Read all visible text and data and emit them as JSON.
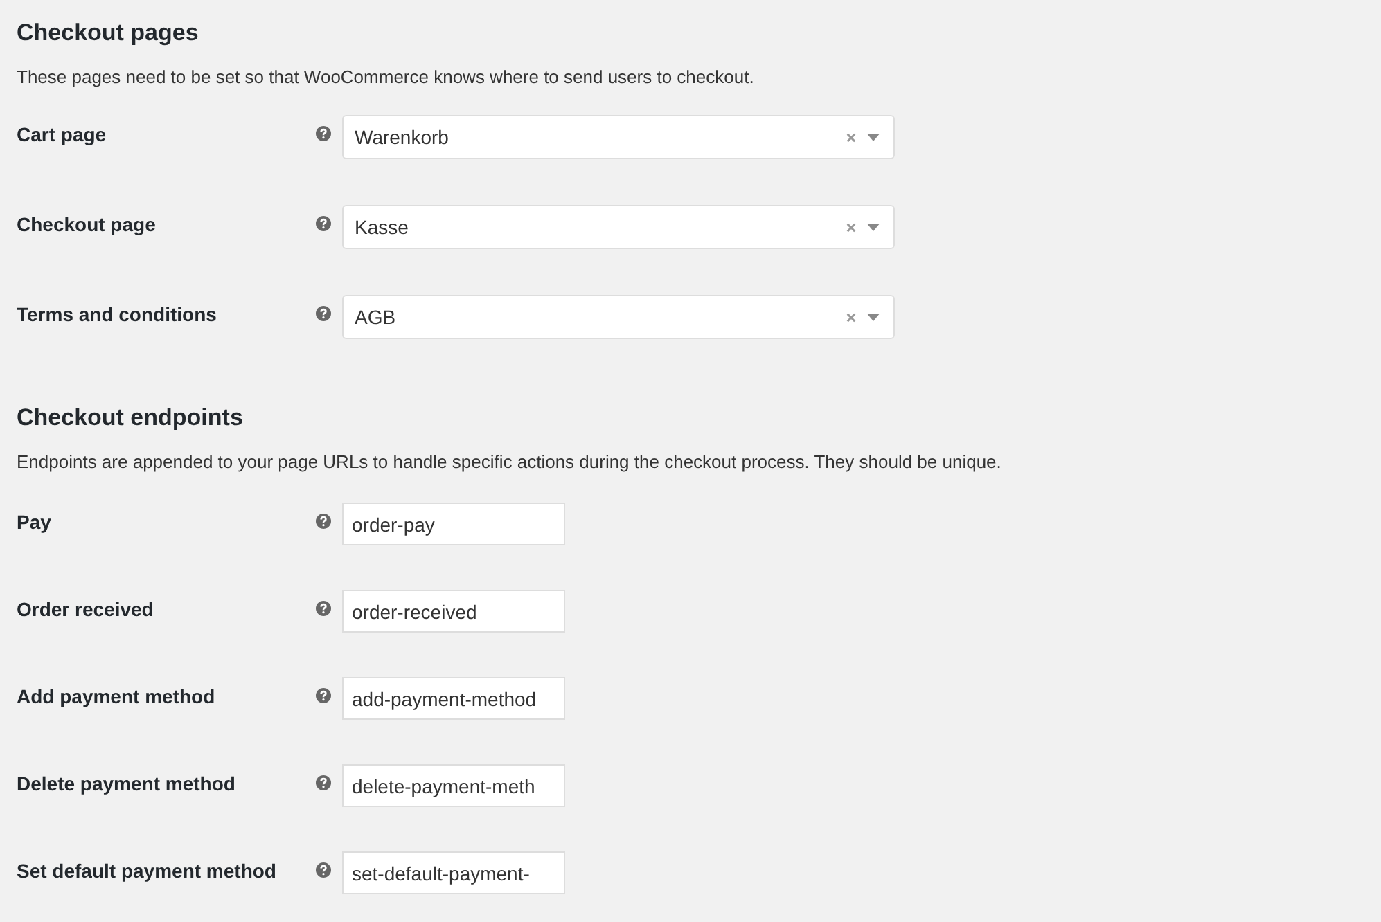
{
  "sections": [
    {
      "title": "Checkout pages",
      "description": "These pages need to be set so that WooCommerce knows where to send users to checkout.",
      "fields": [
        {
          "kind": "select",
          "label": "Cart page",
          "value": "Warenkorb"
        },
        {
          "kind": "select",
          "label": "Checkout page",
          "value": "Kasse"
        },
        {
          "kind": "select",
          "label": "Terms and conditions",
          "value": "AGB"
        }
      ]
    },
    {
      "title": "Checkout endpoints",
      "description": "Endpoints are appended to your page URLs to handle specific actions during the checkout process. They should be unique.",
      "fields": [
        {
          "kind": "text",
          "label": "Pay",
          "value": "order-pay"
        },
        {
          "kind": "text",
          "label": "Order received",
          "value": "order-received"
        },
        {
          "kind": "text",
          "label": "Add payment method",
          "value": "add-payment-method"
        },
        {
          "kind": "text",
          "label": "Delete payment method",
          "value": "delete-payment-meth"
        },
        {
          "kind": "text",
          "label": "Set default payment method",
          "value": "set-default-payment-"
        }
      ]
    }
  ]
}
